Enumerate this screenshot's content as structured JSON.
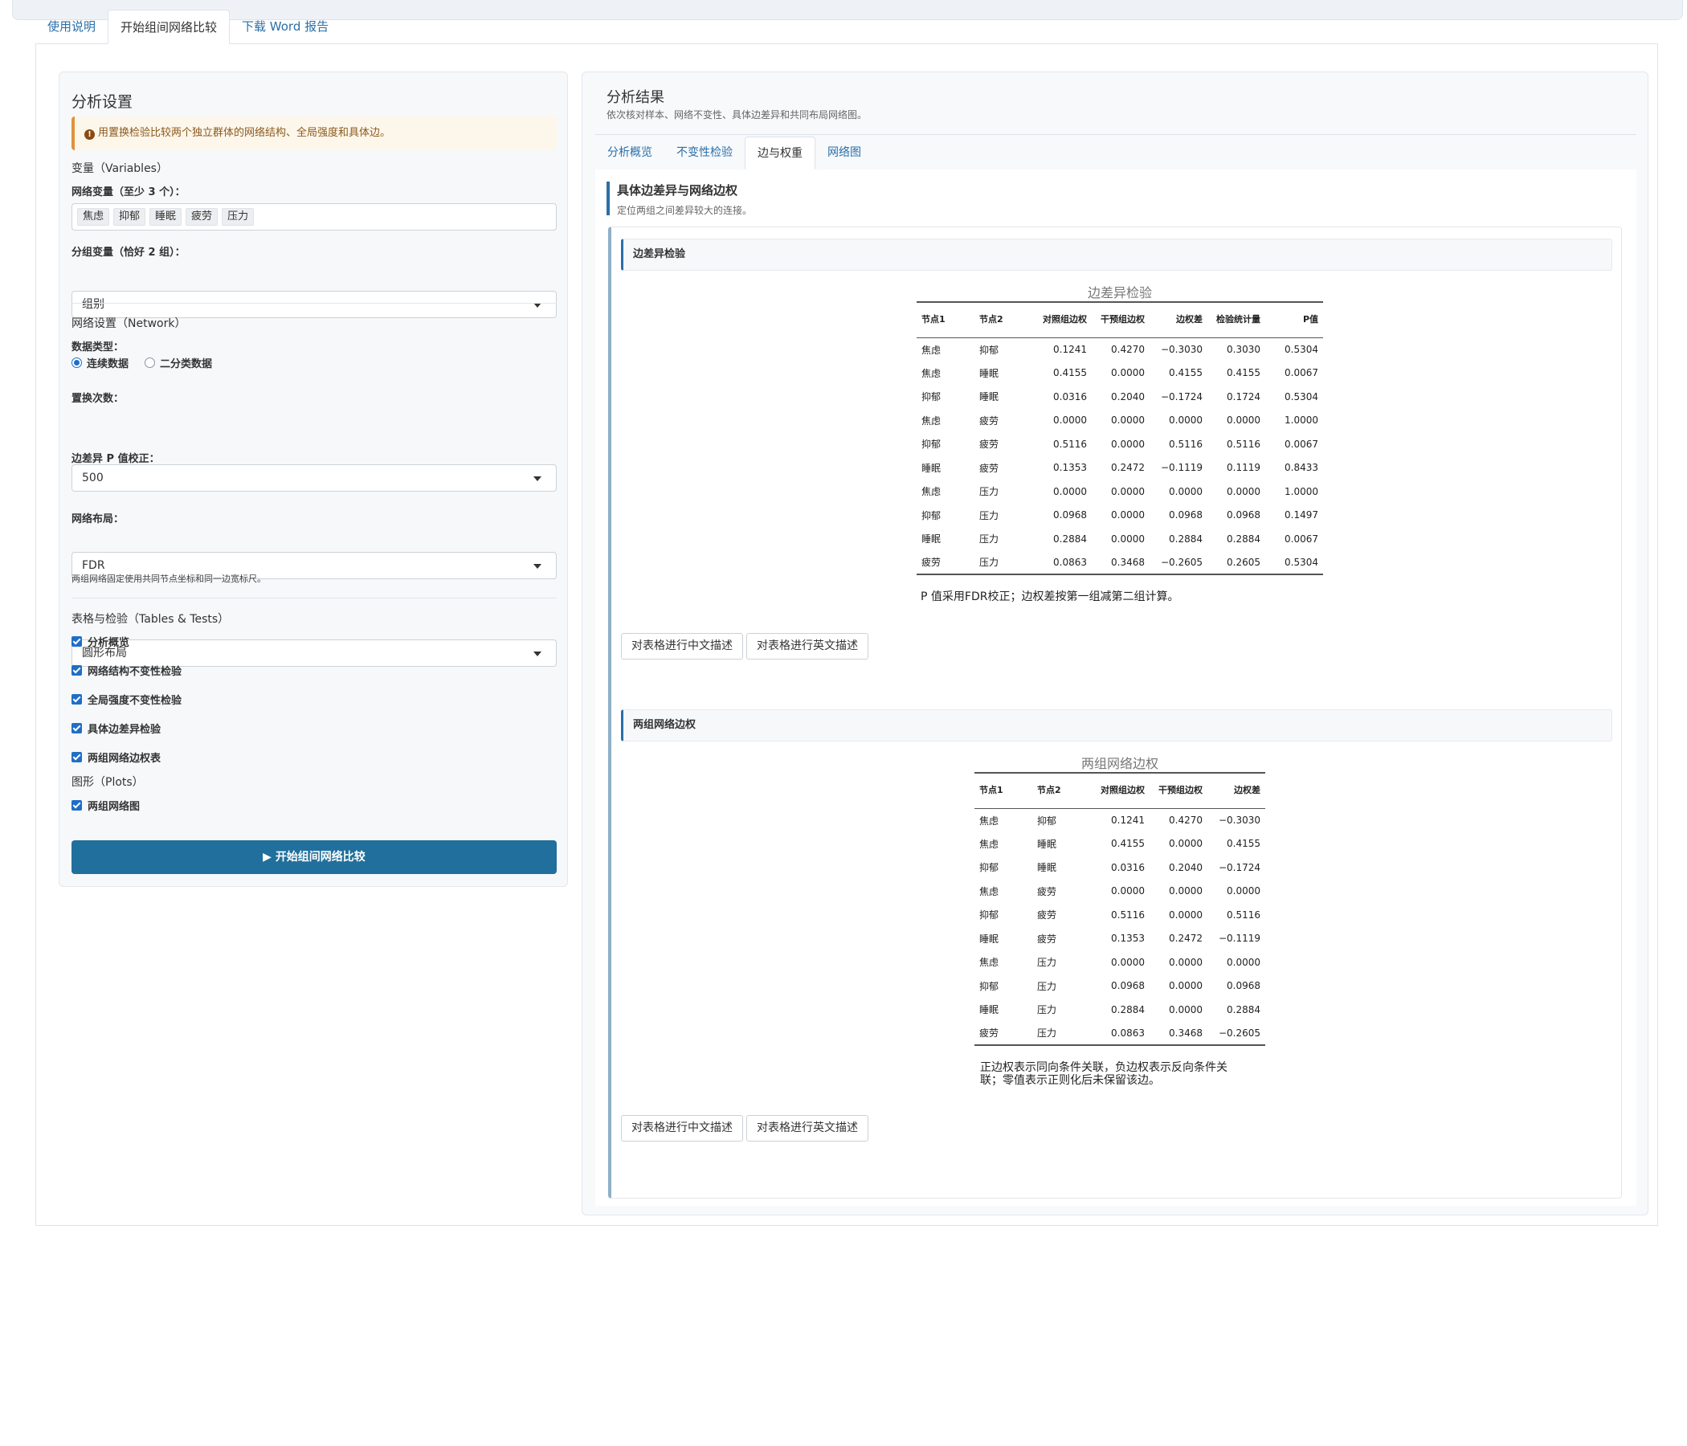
{
  "main_tabs": [
    "使用说明",
    "开始组间网络比较",
    "下载 Word 报告"
  ],
  "sidebar": {
    "title": "分析设置",
    "alert": "用置换检验比较两个独立群体的网络结构、全局强度和具体边。",
    "variables_heading": "变量（Variables）",
    "network_vars_label": "网络变量（至少 3 个）：",
    "network_vars": [
      "焦虑",
      "抑郁",
      "睡眠",
      "疲劳",
      "压力"
    ],
    "group_var_label": "分组变量（恰好 2 组）：",
    "group_var_value": "组别",
    "network_heading": "网络设置（Network）",
    "data_type_label": "数据类型：",
    "data_type_options": [
      "连续数据",
      "二分类数据"
    ],
    "permutations_label": "置换次数：",
    "permutations_value": "500",
    "pcorrection_label": "边差异 P 值校正：",
    "pcorrection_value": "FDR",
    "layout_label": "网络布局：",
    "layout_value": "圆形布局",
    "layout_hint": "两组网络固定使用共同节点坐标和同一边宽标尺。",
    "tables_heading": "表格与检验（Tables & Tests）",
    "tables_options": [
      "分析概览",
      "网络结构不变性检验",
      "全局强度不变性检验",
      "具体边差异检验",
      "两组网络边权表"
    ],
    "plots_heading": "图形（Plots）",
    "plots_options": [
      "两组网络图"
    ],
    "run_label": "▶ 开始组间网络比较"
  },
  "results": {
    "title": "分析结果",
    "subtitle": "依次核对样本、网络不变性、具体边差异和共同布局网络图。",
    "tabs": [
      "分析概览",
      "不变性检验",
      "边与权重",
      "网络图"
    ],
    "section_title": "具体边差异与网络边权",
    "section_sub": "定位两组之间差异较大的连接。",
    "edge_test": {
      "heading": "边差异检验",
      "caption": "边差异检验",
      "columns": [
        "节点1",
        "节点2",
        "对照组边权",
        "干预组边权",
        "边权差",
        "检验统计量",
        "P值"
      ],
      "rows": [
        [
          "焦虑",
          "抑郁",
          "0.1241",
          "0.4270",
          "−0.3030",
          "0.3030",
          "0.5304"
        ],
        [
          "焦虑",
          "睡眠",
          "0.4155",
          "0.0000",
          "0.4155",
          "0.4155",
          "0.0067"
        ],
        [
          "抑郁",
          "睡眠",
          "0.0316",
          "0.2040",
          "−0.1724",
          "0.1724",
          "0.5304"
        ],
        [
          "焦虑",
          "疲劳",
          "0.0000",
          "0.0000",
          "0.0000",
          "0.0000",
          "1.0000"
        ],
        [
          "抑郁",
          "疲劳",
          "0.5116",
          "0.0000",
          "0.5116",
          "0.5116",
          "0.0067"
        ],
        [
          "睡眠",
          "疲劳",
          "0.1353",
          "0.2472",
          "−0.1119",
          "0.1119",
          "0.8433"
        ],
        [
          "焦虑",
          "压力",
          "0.0000",
          "0.0000",
          "0.0000",
          "0.0000",
          "1.0000"
        ],
        [
          "抑郁",
          "压力",
          "0.0968",
          "0.0000",
          "0.0968",
          "0.0968",
          "0.1497"
        ],
        [
          "睡眠",
          "压力",
          "0.2884",
          "0.0000",
          "0.2884",
          "0.2884",
          "0.0067"
        ],
        [
          "疲劳",
          "压力",
          "0.0863",
          "0.3468",
          "−0.2605",
          "0.2605",
          "0.5304"
        ]
      ],
      "note": "P 值采用FDR校正；边权差按第一组减第二组计算。",
      "btn_cn": "对表格进行中文描述",
      "btn_en": "对表格进行英文描述"
    },
    "edge_weights": {
      "heading": "两组网络边权",
      "caption": "两组网络边权",
      "columns": [
        "节点1",
        "节点2",
        "对照组边权",
        "干预组边权",
        "边权差"
      ],
      "rows": [
        [
          "焦虑",
          "抑郁",
          "0.1241",
          "0.4270",
          "−0.3030"
        ],
        [
          "焦虑",
          "睡眠",
          "0.4155",
          "0.0000",
          "0.4155"
        ],
        [
          "抑郁",
          "睡眠",
          "0.0316",
          "0.2040",
          "−0.1724"
        ],
        [
          "焦虑",
          "疲劳",
          "0.0000",
          "0.0000",
          "0.0000"
        ],
        [
          "抑郁",
          "疲劳",
          "0.5116",
          "0.0000",
          "0.5116"
        ],
        [
          "睡眠",
          "疲劳",
          "0.1353",
          "0.2472",
          "−0.1119"
        ],
        [
          "焦虑",
          "压力",
          "0.0000",
          "0.0000",
          "0.0000"
        ],
        [
          "抑郁",
          "压力",
          "0.0968",
          "0.0000",
          "0.0968"
        ],
        [
          "睡眠",
          "压力",
          "0.2884",
          "0.0000",
          "0.2884"
        ],
        [
          "疲劳",
          "压力",
          "0.0863",
          "0.3468",
          "−0.2605"
        ]
      ],
      "note_line1": "正边权表示同向条件关联，负边权表示反向条件关",
      "note_line2": "联；零值表示正则化后未保留该边。",
      "btn_cn": "对表格进行中文描述",
      "btn_en": "对表格进行英文描述"
    }
  }
}
